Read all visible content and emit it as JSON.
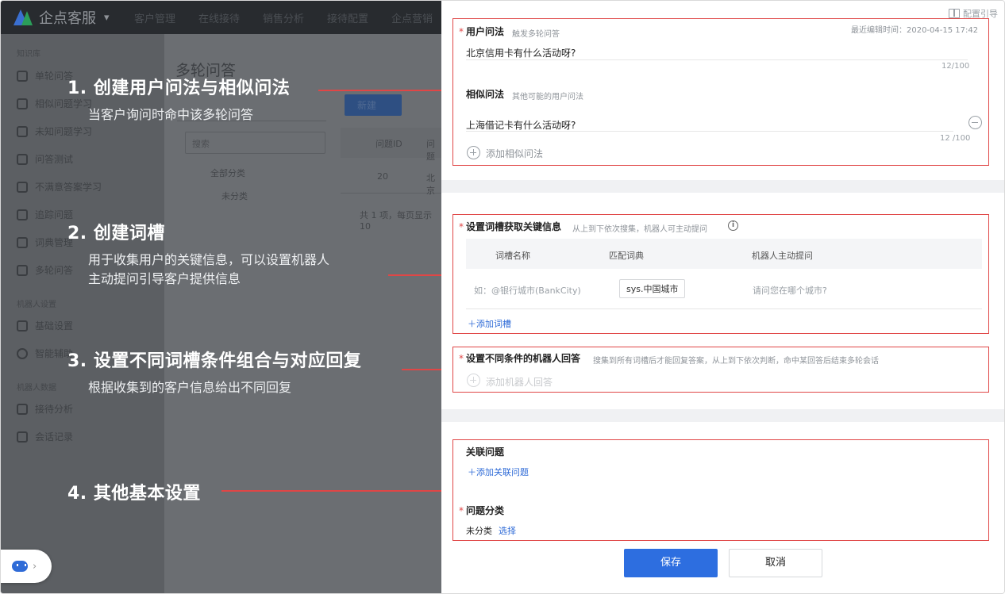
{
  "app": {
    "logo_text": "企点客服",
    "top_nav": [
      "客户管理",
      "在线接待",
      "销售分析",
      "接待配置",
      "企点营销"
    ]
  },
  "sidebar": {
    "group1": "知识库",
    "items1": [
      "单轮问答",
      "相似问题学习",
      "未知问题学习",
      "问答测试",
      "不满意答案学习",
      "追踪问题",
      "词典管理",
      "多轮问答"
    ],
    "group2": "机器人设置",
    "items2": [
      "基础设置",
      "智能辅助"
    ],
    "group3": "机器人数据",
    "items3": [
      "接待分析",
      "会话记录"
    ]
  },
  "background_main": {
    "title": "多轮问答",
    "new_button": "新建",
    "search_placeholder": "搜索",
    "table_header": [
      "问题ID",
      "问题"
    ],
    "tree_all": "全部分类",
    "tree_uncat": "未分类",
    "row_id": "20",
    "row_question": "北京",
    "pager": "共 1 项，每页显示 10"
  },
  "annotations": [
    {
      "title": "1. 创建用户问法与相似问法",
      "sub": [
        "当客户询问时命中该多轮问答"
      ]
    },
    {
      "title": "2. 创建词槽",
      "sub": [
        "用于收集用户的关键信息，可以设置机器人",
        "主动提问引导客户提供信息"
      ]
    },
    {
      "title": "3. 设置不同词槽条件组合与对应回复",
      "sub": [
        "根据收集到的客户信息给出不同回复"
      ]
    },
    {
      "title": "4. 其他基本设置",
      "sub": []
    }
  ],
  "form": {
    "guide_label": "配置引导",
    "last_edit": "最近编辑时间：2020-04-15 17:42",
    "user_question": {
      "label": "用户问法",
      "hint": "触发多轮问答",
      "value": "北京信用卡有什么活动呀?",
      "count": "12/100"
    },
    "similar_question": {
      "label": "相似问法",
      "hint": "其他可能的用户问法",
      "value": "上海借记卡有什么活动呀?",
      "count": "12 /100",
      "add_label": "添加相似问法"
    },
    "slots": {
      "label": "设置词槽获取关键信息",
      "hint": "从上到下依次搜集，机器人可主动提问",
      "columns": [
        "词槽名称",
        "匹配词典",
        "机器人主动提问"
      ],
      "row": {
        "name": "如：@银行城市(BankCity)",
        "dict": "sys.中国城市",
        "prompt": "请问您在哪个城市?"
      },
      "add_label": "添加词槽"
    },
    "answers": {
      "label": "设置不同条件的机器人回答",
      "hint": "搜集到所有词槽后才能回复答案，从上到下依次判断，命中某回答后结束多轮会话",
      "add_label": "添加机器人回答"
    },
    "related": {
      "label": "关联问题",
      "add_label": "添加关联问题"
    },
    "category": {
      "label": "问题分类",
      "value": "未分类",
      "select_label": "选择"
    },
    "save_label": "保存",
    "cancel_label": "取消"
  },
  "colors": {
    "accent": "#2d6ee0",
    "highlight_border": "#e04646",
    "overlay": "#606367"
  }
}
